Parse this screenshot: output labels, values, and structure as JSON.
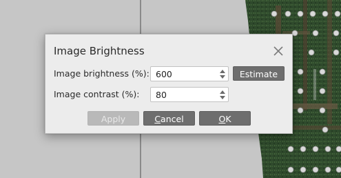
{
  "dialog": {
    "title": "Image Brightness",
    "brightness": {
      "label": "Image brightness (%):",
      "value": "600"
    },
    "contrast": {
      "label": "Image contrast (%):",
      "value": "80"
    },
    "buttons": {
      "estimate": "Estimate",
      "apply": "Apply",
      "cancel_mnemonic": "C",
      "cancel_rest": "ancel",
      "ok_mnemonic": "O",
      "ok_rest": "K"
    }
  },
  "colors": {
    "workspace": "#c6c6c6",
    "dialog_bg": "#ececec",
    "button_dark": "#6e6e6e",
    "button_disabled": "#b9b9b9"
  },
  "icons": {
    "close": "close-icon",
    "spin_up": "arrow-up-icon",
    "spin_down": "arrow-down-icon"
  }
}
